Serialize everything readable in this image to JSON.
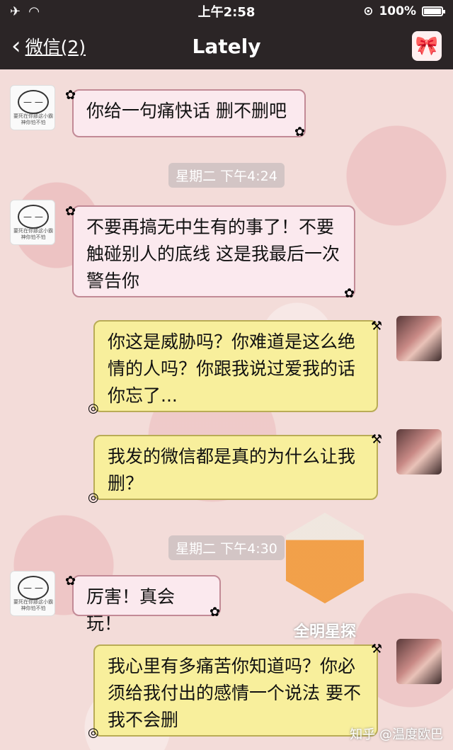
{
  "status_bar": {
    "airplane_icon": "airplane-icon",
    "wifi_icon": "wifi-icon",
    "time": "上午2:58",
    "battery_percent": "100%"
  },
  "nav": {
    "back_label": "微信(2)",
    "title": "Lately"
  },
  "messages": [
    {
      "side": "in",
      "text": "你给一句痛快话 删不删吧"
    },
    {
      "side": "in",
      "text": "不要再搞无中生有的事了！不要触碰别人的底线 这是我最后一次警告你"
    },
    {
      "side": "out",
      "text": "你这是威胁吗？你难道是这么绝情的人吗？你跟我说过爱我的话你忘了..."
    },
    {
      "side": "out",
      "text": "我发的微信都是真的为什么让我删？"
    },
    {
      "side": "in",
      "text": "厉害！真会玩！"
    },
    {
      "side": "out",
      "text": "我心里有多痛苦你知道吗？你必须给我付出的感情一个说法 要不我不会删"
    }
  ],
  "timestamps": [
    "星期二 下午4:24",
    "星期二 下午4:30"
  ],
  "avatar_caption": "要死在你那这小霸神你怕不怕",
  "watermark": "全明星探",
  "footer_watermark": "知乎 @温度欧巴",
  "colors": {
    "topbar": "#2b2526",
    "incoming_bubble": "#fbe9ee",
    "outgoing_bubble": "#f8ef9c"
  }
}
